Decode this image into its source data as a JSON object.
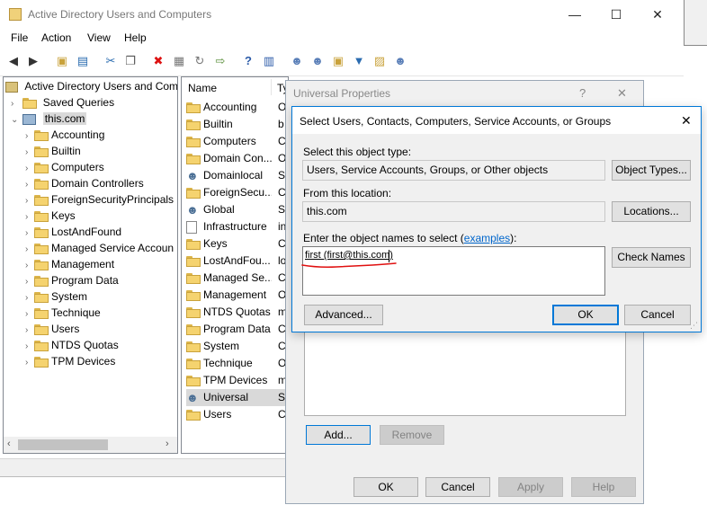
{
  "main_window": {
    "title": "Active Directory Users and Computers",
    "menu": [
      "File",
      "Action",
      "View",
      "Help"
    ],
    "min_glyph": "—",
    "max_glyph": "☐",
    "close_glyph": "✕"
  },
  "tree": {
    "root": "Active Directory Users and Com",
    "saved_queries": "Saved Queries",
    "domain": "this.com",
    "items": [
      "Accounting",
      "Builtin",
      "Computers",
      "Domain Controllers",
      "ForeignSecurityPrincipals",
      "Keys",
      "LostAndFound",
      "Managed Service Accoun",
      "Management",
      "Program Data",
      "System",
      "Technique",
      "Users",
      "NTDS Quotas",
      "TPM Devices"
    ]
  },
  "list": {
    "col_name": "Name",
    "col_type": "Ty",
    "rows": [
      {
        "name": "Accounting",
        "type": "O"
      },
      {
        "name": "Builtin",
        "type": "b"
      },
      {
        "name": "Computers",
        "type": "C"
      },
      {
        "name": "Domain Con...",
        "type": "O"
      },
      {
        "name": "Domainlocal",
        "type": "S"
      },
      {
        "name": "ForeignSecu...",
        "type": "C"
      },
      {
        "name": "Global",
        "type": "S"
      },
      {
        "name": "Infrastructure",
        "type": "in"
      },
      {
        "name": "Keys",
        "type": "C"
      },
      {
        "name": "LostAndFou...",
        "type": "lo"
      },
      {
        "name": "Managed Se...",
        "type": "C"
      },
      {
        "name": "Management",
        "type": "O"
      },
      {
        "name": "NTDS Quotas",
        "type": "m"
      },
      {
        "name": "Program Data",
        "type": "C"
      },
      {
        "name": "System",
        "type": "C"
      },
      {
        "name": "Technique",
        "type": "O"
      },
      {
        "name": "TPM Devices",
        "type": "m"
      },
      {
        "name": "Universal",
        "type": "S"
      },
      {
        "name": "Users",
        "type": "C"
      }
    ]
  },
  "universal_dialog": {
    "title": "Universal Properties",
    "help_glyph": "?",
    "close_glyph": "✕",
    "add_label": "Add...",
    "remove_label": "Remove",
    "ok_label": "OK",
    "cancel_label": "Cancel",
    "apply_label": "Apply",
    "help_label": "Help"
  },
  "select_dialog": {
    "title": "Select Users, Contacts, Computers, Service Accounts, or Groups",
    "close_glyph": "✕",
    "object_type_label": "Select this object type:",
    "object_type_value": "Users, Service Accounts, Groups, or Other objects",
    "object_types_button": "Object Types...",
    "location_label": "From this location:",
    "location_value": "this.com",
    "locations_button": "Locations...",
    "names_label_pre": "Enter the object names to select (",
    "names_label_link": "examples",
    "names_label_post": "):",
    "names_value": "first (first@this.com)",
    "check_names_button": "Check Names",
    "advanced_button": "Advanced...",
    "ok_button": "OK",
    "cancel_button": "Cancel"
  },
  "colors": {
    "annotation": "#e01010",
    "accent": "#0078d7",
    "link": "#0066cc",
    "selected_row": "#d9d9d9"
  }
}
